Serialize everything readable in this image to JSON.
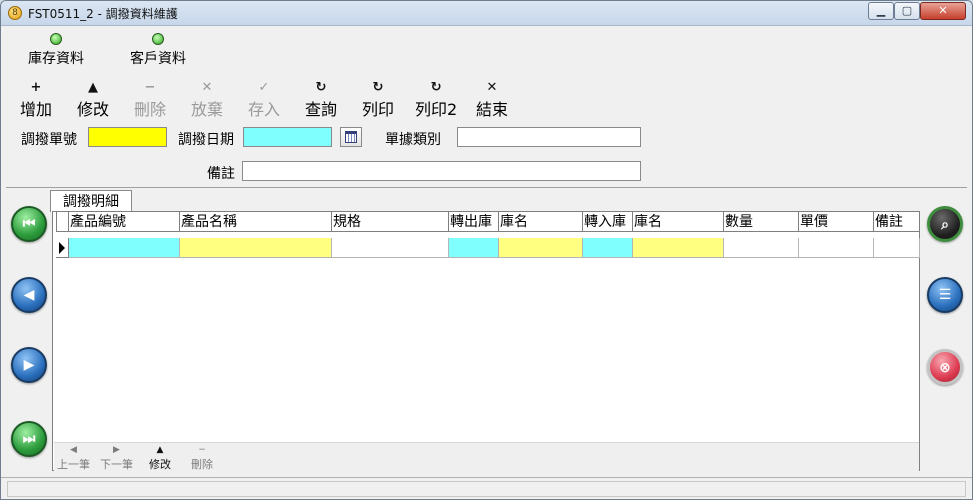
{
  "window": {
    "title": "FST0511_2 - 調撥資料維護",
    "min_icon": "minimize-icon",
    "max_icon": "maximize-icon",
    "close_icon": "close-icon"
  },
  "top_tabs": [
    {
      "label": "庫存資料"
    },
    {
      "label": "客戶資料"
    }
  ],
  "toolbar": {
    "add": "增加",
    "edit": "修改",
    "delete": "刪除",
    "discard": "放棄",
    "save": "存入",
    "query": "查詢",
    "print": "列印",
    "print2": "列印2",
    "exit": "結束"
  },
  "form": {
    "transfer_no_label": "調撥單號",
    "transfer_no_value": "",
    "transfer_date_label": "調撥日期",
    "transfer_date_value": "",
    "doc_type_label": "單據類別",
    "doc_type_value": "",
    "remark_label": "備註",
    "remark_value": ""
  },
  "detail_tab": {
    "label": "調撥明細"
  },
  "grid": {
    "columns": [
      "產品編號",
      "產品名稱",
      "規格",
      "轉出庫",
      "庫名",
      "轉入庫",
      "庫名",
      "數量",
      "單價",
      "備註"
    ],
    "rows": [
      [
        "",
        "",
        "",
        "",
        "",
        "",
        "",
        "",
        "",
        ""
      ]
    ]
  },
  "grid_footer": {
    "prev": "上一筆",
    "next": "下一筆",
    "edit": "修改",
    "delete": "刪除"
  },
  "colors": {
    "required_yellow": "#ffff00",
    "key_cyan": "#80ffff"
  }
}
